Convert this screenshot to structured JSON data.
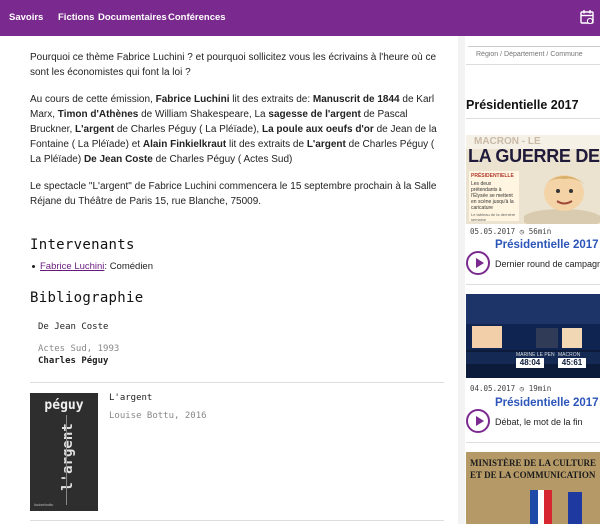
{
  "nav": {
    "items": [
      "Savoirs",
      "Fictions",
      "Documentaires",
      "Conférences"
    ],
    "calendar_icon": "calendar-icon"
  },
  "article": {
    "intro": "Pourquoi ce thème Fabrice Luchini ? et pourquoi sollicitez vous les écrivains à l'heure où ce sont les économistes qui font la loi ?",
    "paragraph2": [
      {
        "t": "Au cours de cette émission, ",
        "b": false
      },
      {
        "t": "Fabrice Luchini",
        "b": true
      },
      {
        "t": " lit des extraits de: ",
        "b": false
      },
      {
        "t": "Manuscrit de 1844",
        "b": true
      },
      {
        "t": " de Karl Marx, ",
        "b": false
      },
      {
        "t": "Timon d'Athènes",
        "b": true
      },
      {
        "t": " de William Shakespeare, La ",
        "b": false
      },
      {
        "t": "sagesse de l'argent",
        "b": true
      },
      {
        "t": " de Pascal Bruckner, ",
        "b": false
      },
      {
        "t": "L'argent",
        "b": true
      },
      {
        "t": " de Charles Péguy ( La Pléïade), ",
        "b": false
      },
      {
        "t": "La poule aux oeufs d'or",
        "b": true
      },
      {
        "t": " de Jean de la Fontaine ( La Pléïade) et ",
        "b": false
      },
      {
        "t": "Alain Finkielkraut",
        "b": true
      },
      {
        "t": " lit des extraits de ",
        "b": false
      },
      {
        "t": "L'argent",
        "b": true
      },
      {
        "t": " de Charles Péguy ( La Pléïade) ",
        "b": false
      },
      {
        "t": "De Jean Coste",
        "b": true
      },
      {
        "t": " de Charles Péguy ( Actes Sud)",
        "b": false
      }
    ],
    "paragraph3": "Le spectacle \"L'argent\" de Fabrice Luchini commencera le 15 septembre prochain à la Salle Réjane du Théâtre de Paris 15, rue Blanche, 75009."
  },
  "intervenants": {
    "heading": "Intervenants",
    "items": [
      {
        "name": "Fabrice Luchini",
        "role": " : Comédien"
      }
    ]
  },
  "bibliographie": {
    "heading": "Bibliographie",
    "books": [
      {
        "title": "De Jean Coste",
        "publisher": "Actes Sud, 1993",
        "author": "Charles Péguy"
      },
      {
        "title": "L'argent",
        "publisher": "Louise Bottu, 2016",
        "cover_top": "péguy",
        "cover_vertical": "l'argent",
        "cover_foot": "louisebottu"
      }
    ]
  },
  "sidebar": {
    "region_placeholder": "Région / Département / Commune",
    "section_title": "Présidentielle 2017",
    "cards": [
      {
        "meta": "05.05.2017 ◷ 56min",
        "title": "Présidentielle 2017",
        "subtitle": "Dernier round de campagne",
        "image": {
          "headline": "LA GUERRE DES IM",
          "top": "MACRON - LE",
          "box_title": "PRÉSIDENTIELLE",
          "box_text": "Les deux prétendants à l'Élysée se mettent en scène jusqu'à la caricature",
          "box_foot": "Le tableau de la dernière semaine"
        }
      },
      {
        "meta": "04.05.2017 ◷ 19min",
        "title": "Présidentielle 2017",
        "subtitle": "Débat, le mot de la fin",
        "image": {
          "score_left": "MARINE LE PEN",
          "score_right": "MACRON",
          "val_left": "48:04",
          "val_right": "45:61"
        }
      },
      {
        "image": {
          "line1": "MINISTÈRE DE LA CULTURE",
          "line2": "ET DE LA COMMUNICATION"
        }
      }
    ]
  }
}
